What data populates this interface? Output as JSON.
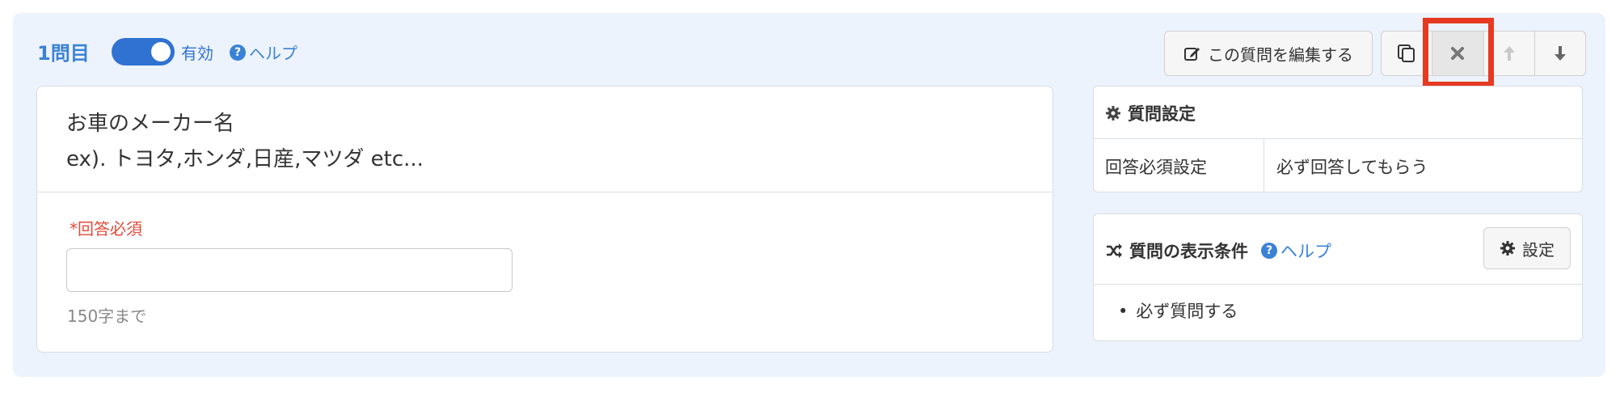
{
  "header": {
    "question_number": "1問目",
    "toggle_label": "有効",
    "toggle_on": true,
    "help_label": "ヘルプ"
  },
  "toolbar": {
    "edit_label": "この質問を編集する"
  },
  "question": {
    "title_line1": "お車のメーカー名",
    "title_line2": "ex). トヨタ,ホンダ,日産,マツダ etc...",
    "required_label": "*回答必須",
    "answer_value": "",
    "char_limit": "150字まで"
  },
  "settings": {
    "title": "質問設定",
    "row_key": "回答必須設定",
    "row_value": "必ず回答してもらう"
  },
  "conditions": {
    "title": "質問の表示条件",
    "help_label": "ヘルプ",
    "setting_button": "設定",
    "item": "必ず質問する"
  },
  "colors": {
    "accent": "#3b82d6",
    "panel_bg": "#edf3fc",
    "required_red": "#e24b3b",
    "highlight_red": "#e53a21"
  }
}
